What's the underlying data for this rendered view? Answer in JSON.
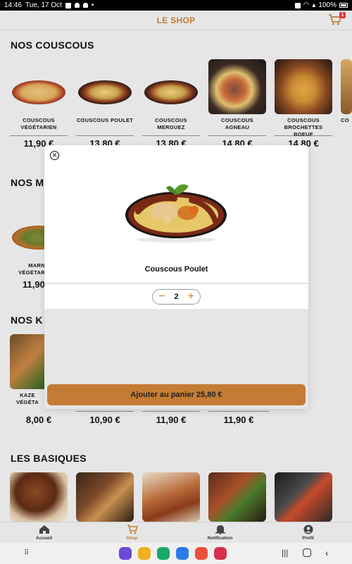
{
  "status_bar": {
    "time": "14:46",
    "date": "Tue, 17 Oct",
    "battery": "100%"
  },
  "header": {
    "title": "LE SHOP",
    "cart_count": "1"
  },
  "sections": {
    "couscous": {
      "title": "NOS COUSCOUS",
      "items": [
        {
          "name": "COUSCOUS VÉGÉTARIEN",
          "price": "11,90 €"
        },
        {
          "name": "COUSCOUS POULET",
          "price": "13,80 €"
        },
        {
          "name": "COUSCOUS MERGUEZ",
          "price": "13,80 €"
        },
        {
          "name": "COUSCOUS AGNEAU",
          "price": "14,80 €"
        },
        {
          "name": "COUSCOUS BROCHETTES BOEUF",
          "price": "14,80 €"
        },
        {
          "name": "CO",
          "price": ""
        }
      ]
    },
    "second": {
      "title": "NOS M",
      "items": [
        {
          "name": "MARN VÉGÉTAR",
          "price": "11,90"
        }
      ]
    },
    "third": {
      "title": "NOS K",
      "items": [
        {
          "name": "KAZE VÉGÉTA",
          "price": "8,00 €"
        },
        {
          "name": "",
          "price": "10,90 €"
        },
        {
          "name": "",
          "price": "11,90 €"
        },
        {
          "name": "",
          "price": "11,90 €"
        }
      ]
    },
    "basics": {
      "title": "LES BASIQUES"
    }
  },
  "modal": {
    "dish_name": "Couscous Poulet",
    "quantity": "2",
    "minus": "−",
    "plus": "+",
    "close": "✕",
    "add_button": "Ajouter au panier 25,80 €"
  },
  "bottom_nav": [
    {
      "label": "Accueil",
      "icon": "home-icon"
    },
    {
      "label": "Shop",
      "icon": "cart-icon"
    },
    {
      "label": "Notification",
      "icon": "bell-icon"
    },
    {
      "label": "Profil",
      "icon": "profile-icon"
    }
  ],
  "colors": {
    "accent": "#c47c35",
    "badge": "#d9344a",
    "background": "#e6e6e6"
  }
}
